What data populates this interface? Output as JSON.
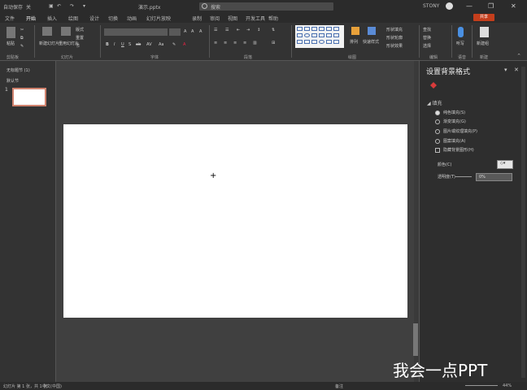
{
  "titlebar": {
    "autosave_label": "自动保存",
    "autosave_state": "关",
    "filename": "演示.pptx",
    "search_placeholder": "搜索",
    "user_name": "STONY"
  },
  "tabs": [
    "文件",
    "开始",
    "插入",
    "绘图",
    "设计",
    "切换",
    "动画",
    "幻灯片放映",
    "录制",
    "审阅",
    "视图",
    "开发工具",
    "帮助"
  ],
  "active_tab": "开始",
  "share_label": "共享",
  "ribbon": {
    "groups": [
      "剪贴板",
      "幻灯片",
      "字体",
      "段落",
      "绘图",
      "编辑",
      "语音",
      "新建"
    ],
    "clipboard": {
      "paste": "粘贴"
    },
    "slides": {
      "new_slide": "新建幻灯片",
      "reuse": "重用幻灯片",
      "layout": "版式",
      "reset": "重置",
      "section": "节"
    },
    "drawing": {
      "arrange": "排列",
      "quick_styles": "快速样式",
      "shape_fill": "形状填充",
      "shape_outline": "形状轮廓",
      "shape_effects": "形状效果"
    },
    "editing": {
      "find": "查找",
      "replace": "替换",
      "select": "选择"
    },
    "voice": {
      "dictate": "听写"
    },
    "new_group": {
      "new_button": "新建组"
    }
  },
  "thumbnails": {
    "sections": [
      "无标题节 (1)",
      "默认节"
    ],
    "slide_number": "1"
  },
  "format_pane": {
    "title": "设置背景格式",
    "fill_header": "填充",
    "options": [
      {
        "label": "纯色填充(S)",
        "selected": true,
        "type": "radio"
      },
      {
        "label": "渐变填充(G)",
        "selected": false,
        "type": "radio"
      },
      {
        "label": "图片或纹理填充(P)",
        "selected": false,
        "type": "radio"
      },
      {
        "label": "图案填充(A)",
        "selected": false,
        "type": "radio"
      },
      {
        "label": "隐藏背景图形(H)",
        "selected": false,
        "type": "checkbox"
      }
    ],
    "color_label": "颜色(C)",
    "transparency_label": "透明度(T)",
    "transparency_value": "0%"
  },
  "statusbar": {
    "slide_info": "幻灯片 第 1 张，共 1 张",
    "language": "中文(中国)",
    "notes": "备注",
    "zoom": "44%"
  },
  "watermark": "我会一点PPT",
  "colors": {
    "accent": "#c43e1c",
    "slide_bg": "#ffffff",
    "pane_bg": "#2e2e2e"
  }
}
